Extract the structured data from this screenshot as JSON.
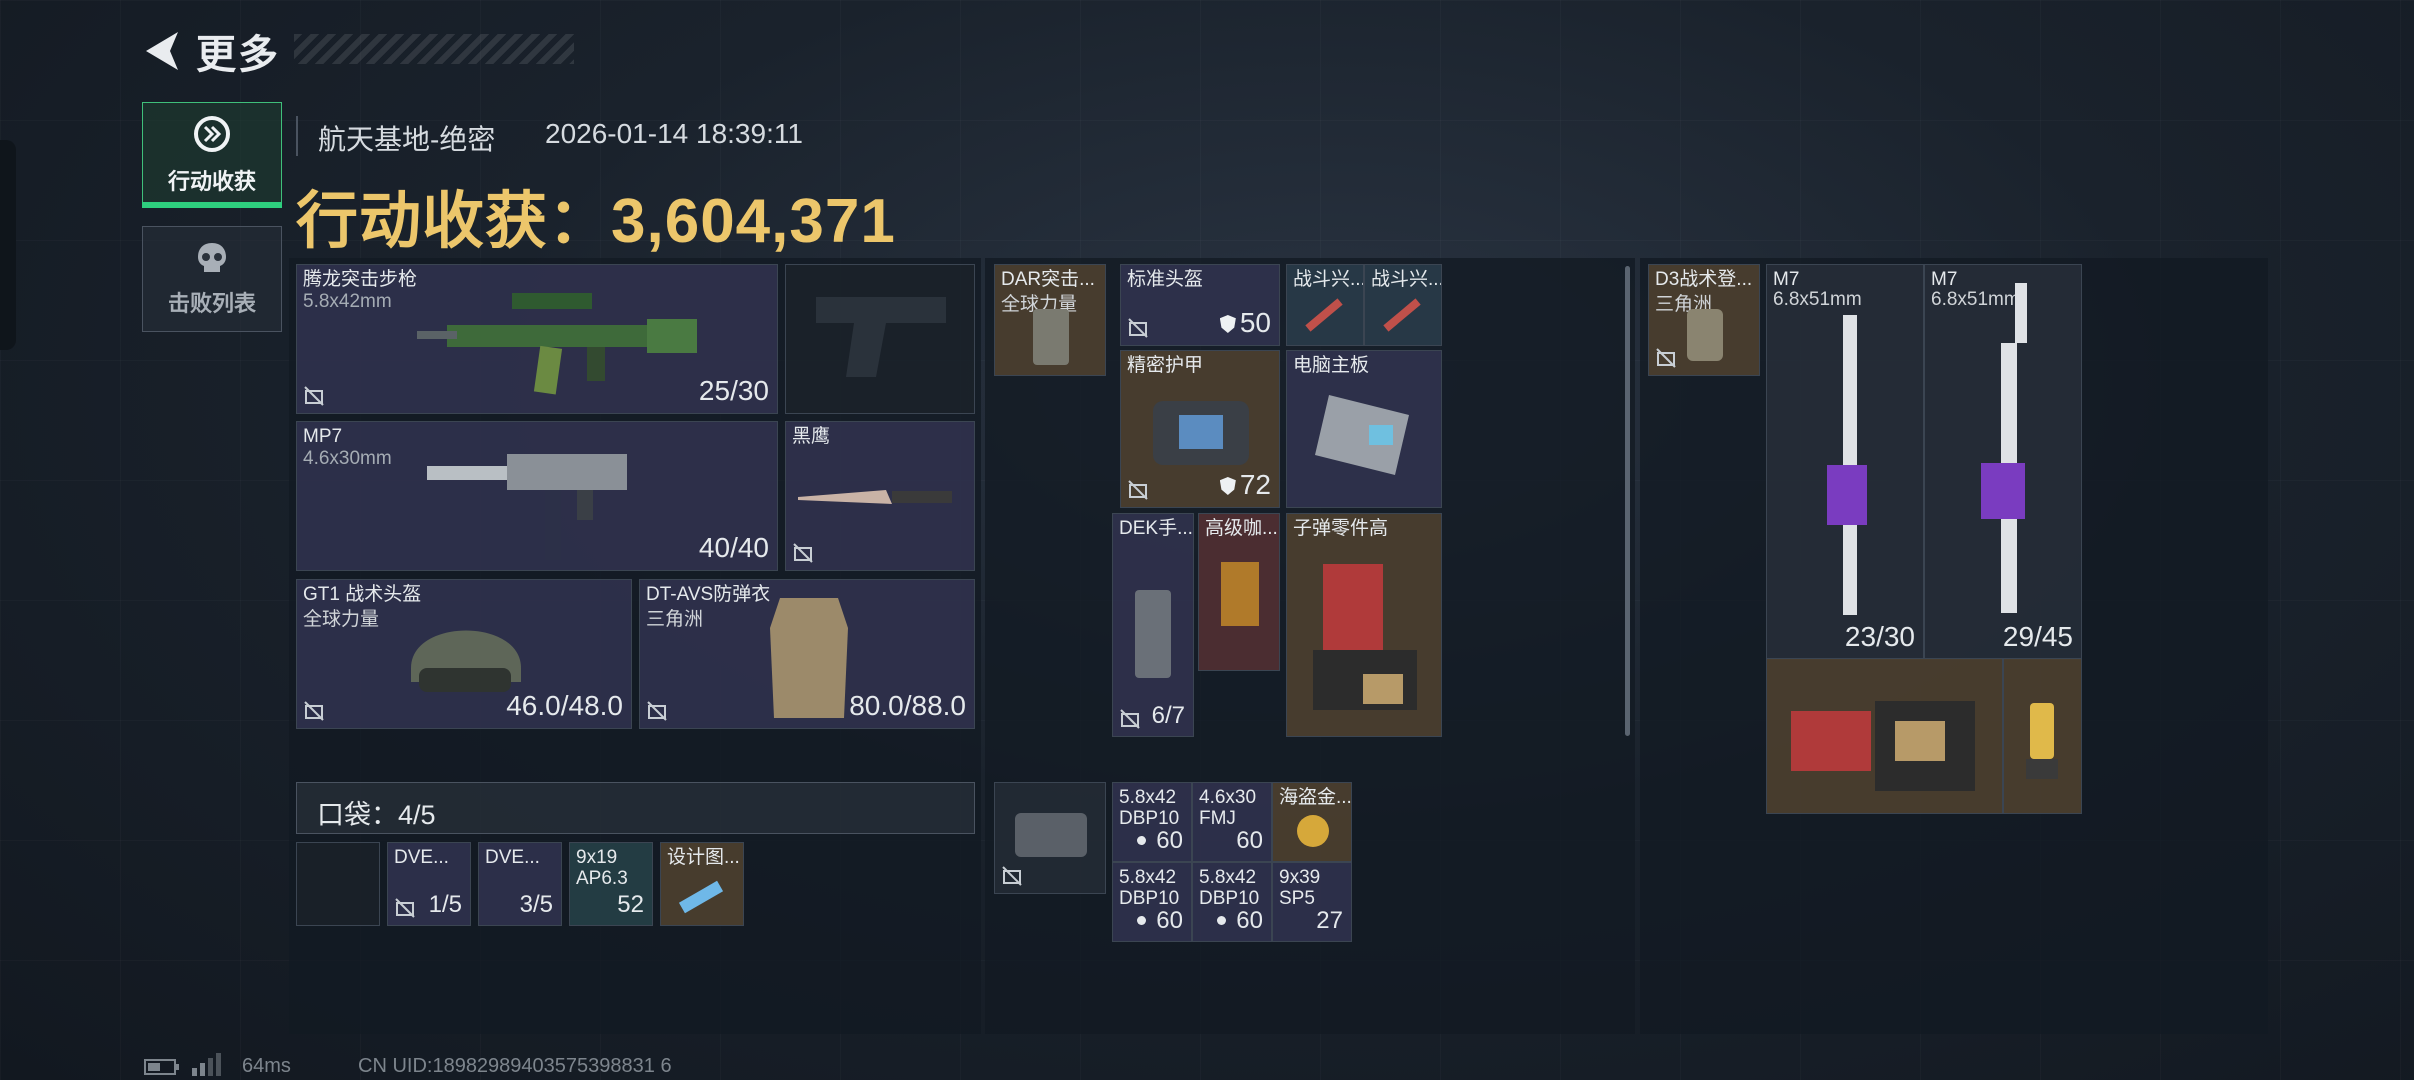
{
  "header": {
    "back_title": "更多"
  },
  "nav": [
    {
      "label": "行动收获",
      "icon": "loot-icon",
      "active": true
    },
    {
      "label": "击败列表",
      "icon": "skull-icon",
      "active": false
    }
  ],
  "info": {
    "map": "航天基地-绝密",
    "timestamp": "2026-01-14 18:39:11",
    "earnings_label": "行动收获：",
    "earnings_value": "3,604,371"
  },
  "equipment": {
    "primary": {
      "name": "腾龙突击步枪",
      "ammo_type": "5.8x42mm",
      "ammo": "25/30"
    },
    "secondary": {
      "name": "MP7",
      "ammo_type": "4.6x30mm",
      "ammo": "40/40"
    },
    "melee": {
      "name": "黑鹰"
    },
    "helmet": {
      "name": "GT1 战术头盔",
      "brand": "全球力量",
      "durability": "46.0/48.0"
    },
    "armor": {
      "name": "DT-AVS防弹衣",
      "brand": "三角洲",
      "durability": "80.0/88.0"
    }
  },
  "pocket": {
    "label": "口袋：4/5",
    "items": [
      {
        "name": "",
        "count": ""
      },
      {
        "name": "DVE...",
        "count": "1/5"
      },
      {
        "name": "DVE...",
        "count": "3/5"
      },
      {
        "name": "9x19 AP6.3",
        "count": "52"
      },
      {
        "name": "设计图...",
        "count": ""
      }
    ]
  },
  "rig": {
    "name": "DAR突击...",
    "brand": "全球力量"
  },
  "rig_items": [
    {
      "name": "标准头盔",
      "count": "50"
    },
    {
      "name": "战斗兴...",
      "count": ""
    },
    {
      "name": "战斗兴...",
      "count": ""
    },
    {
      "name": "精密护甲",
      "count": "72"
    },
    {
      "name": "电脑主板",
      "count": ""
    },
    {
      "name": "DEK手...",
      "count": "6/7"
    },
    {
      "name": "高级咖...",
      "count": ""
    },
    {
      "name": "子弹零件高",
      "count": ""
    }
  ],
  "case_items": [
    {
      "name": "5.8x42 DBP10",
      "count": "60"
    },
    {
      "name": "4.6x30 FMJ",
      "count": "60"
    },
    {
      "name": "海盗金...",
      "count": ""
    },
    {
      "name": "5.8x42 DBP10",
      "count": "60"
    },
    {
      "name": "5.8x42 DBP10",
      "count": "60"
    },
    {
      "name": "9x39 SP5",
      "count": "27"
    }
  ],
  "backpack": {
    "name": "D3战术登...",
    "brand": "三角洲"
  },
  "backpack_items": [
    {
      "name": "M7",
      "ammo_type": "6.8x51mm",
      "ammo": "23/30"
    },
    {
      "name": "M7",
      "ammo_type": "6.8x51mm",
      "ammo": "29/45"
    }
  ],
  "footer": {
    "ping": "64ms",
    "uid": "CN UID:18982989403575398831 6"
  },
  "colors": {
    "accent_green": "#2ecf7e",
    "gold": "#ecc66b"
  }
}
